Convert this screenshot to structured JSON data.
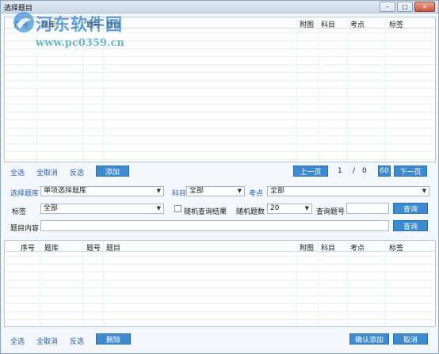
{
  "window": {
    "title": "选择题目",
    "min_glyph": "–",
    "restore_glyph": "□",
    "close_glyph": "×"
  },
  "watermark": {
    "name": "河东软件园",
    "url": "www.pc0359.cn"
  },
  "top_table": {
    "columns": [
      "序号",
      "题库",
      "题号",
      "题目",
      "附图",
      "科目",
      "考点",
      "标签"
    ],
    "rows": []
  },
  "top_actions": {
    "select_all": "全选",
    "deselect_all": "全取消",
    "invert": "反选",
    "add": "添加"
  },
  "pager": {
    "prev": "上一页",
    "current": "1",
    "separator": "/",
    "total": "0",
    "page_size": "60",
    "next": "下一页"
  },
  "filters": {
    "bank_label": "选择题库",
    "bank_value": "单项选择题库",
    "subject_label": "科目",
    "subject_value": "全部",
    "point_label": "考点",
    "point_value": "全部",
    "tag_label": "标签",
    "tag_value": "全部",
    "random_label": "随机查询结果",
    "random_count_label": "随机题数",
    "random_count_value": "20",
    "query_number_label": "查询题号",
    "query_number_value": "",
    "query_button": "查询",
    "content_label": "题目内容",
    "content_value": "",
    "content_query_button": "查询"
  },
  "bottom_table": {
    "columns": [
      "序号",
      "题库",
      "题号",
      "题目",
      "附图",
      "科目",
      "考点",
      "标签"
    ],
    "rows": []
  },
  "bottom_actions": {
    "select_all": "全选",
    "deselect_all": "全取消",
    "invert": "反选",
    "delete": "删除",
    "confirm_add": "确认添加",
    "cancel": "取消"
  },
  "colors": {
    "accent": "#3c8ad0",
    "link": "#2b64b8"
  }
}
